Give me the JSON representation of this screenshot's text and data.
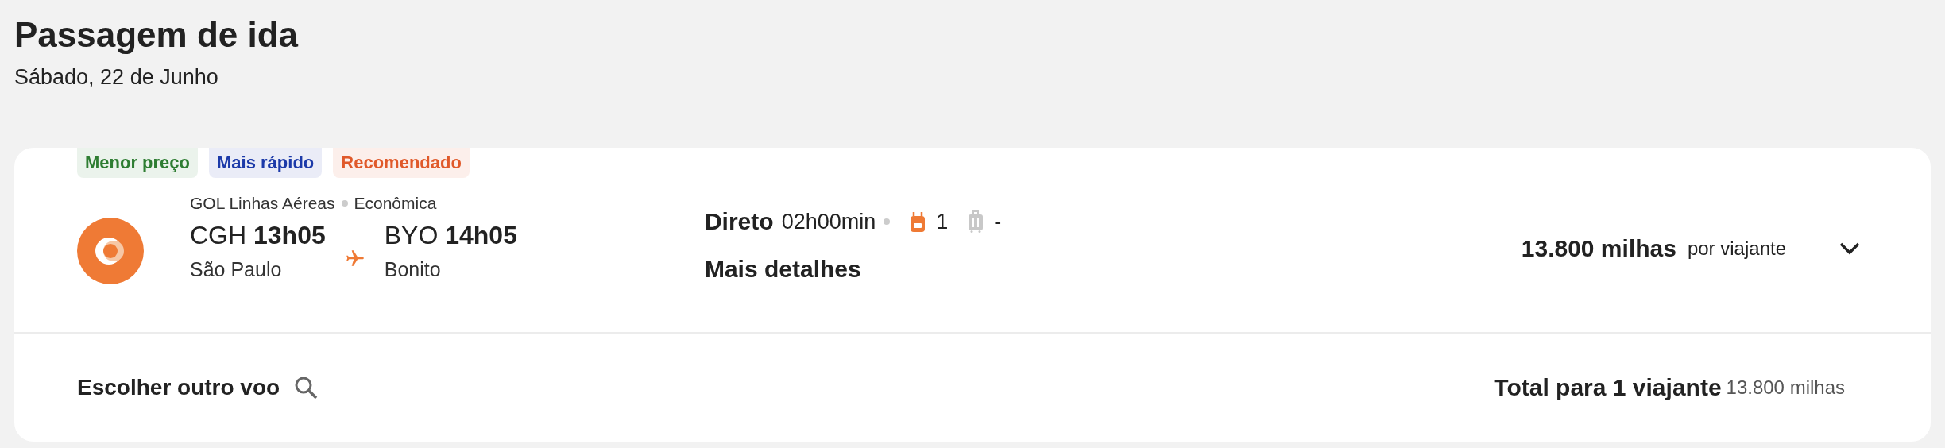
{
  "header": {
    "title": "Passagem de ida",
    "date": "Sábado, 22 de Junho"
  },
  "flight": {
    "tags": [
      {
        "label": "Menor preço",
        "color": "#2e7d32"
      },
      {
        "label": "Mais rápido",
        "color": "#1c3aa9"
      },
      {
        "label": "Recomendado",
        "color": "#e0592a"
      }
    ],
    "airline": "GOL Linhas Aéreas",
    "cabin": "Econômica",
    "origin": {
      "code": "CGH",
      "time": "13h05",
      "city": "São Paulo"
    },
    "destination": {
      "code": "BYO",
      "time": "14h05",
      "city": "Bonito"
    },
    "stops": "Direto",
    "duration": "02h00min",
    "baggage": [
      {
        "kind": "backpack",
        "count": "1",
        "included": true
      },
      {
        "kind": "suitcase",
        "count": "-",
        "included": false
      }
    ],
    "details_link": "Mais detalhes",
    "price": "13.800 milhas",
    "price_unit": "por viajante",
    "expanded": false
  },
  "footer": {
    "choose_other": "Escolher outro voo",
    "total_label": "Total para 1 viajante",
    "total_value": "13.800 milhas"
  }
}
